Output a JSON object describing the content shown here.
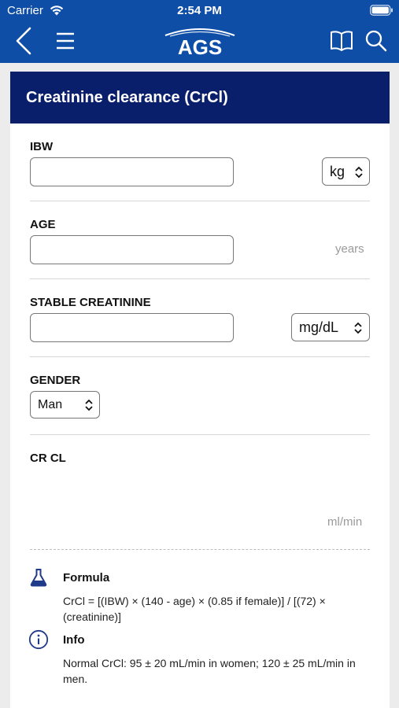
{
  "status_bar": {
    "carrier": "Carrier",
    "time": "2:54 PM"
  },
  "nav": {
    "logo_text": "AGS"
  },
  "calculator": {
    "title": "Creatinine clearance (CrCl)",
    "fields": {
      "ibw": {
        "label": "IBW",
        "value": "",
        "unit": "kg"
      },
      "age": {
        "label": "AGE",
        "value": "",
        "unit": "years"
      },
      "creatinine": {
        "label": "STABLE CREATININE",
        "value": "",
        "unit": "mg/dL"
      },
      "gender": {
        "label": "GENDER",
        "value": "Man"
      }
    },
    "result": {
      "label": "CR CL",
      "value": "",
      "unit": "ml/min"
    },
    "formula": {
      "heading": "Formula",
      "text": "CrCl = [(IBW) × (140 - age) × (0.85 if female)] / [(72) × (creatinine)]"
    },
    "info": {
      "heading": "Info",
      "text": "Normal CrCl: 95 ± 20 mL/min in women; 120 ± 25 mL/min in men."
    }
  },
  "colors": {
    "nav_bar": "#0f4ea6",
    "card_header": "#0a1f6b",
    "icon_accent": "#1f3a8a"
  },
  "icons": [
    "wifi-icon",
    "battery-icon",
    "back-icon",
    "menu-icon",
    "book-icon",
    "search-icon",
    "flask-icon",
    "info-icon",
    "chevron-updown-icon"
  ]
}
